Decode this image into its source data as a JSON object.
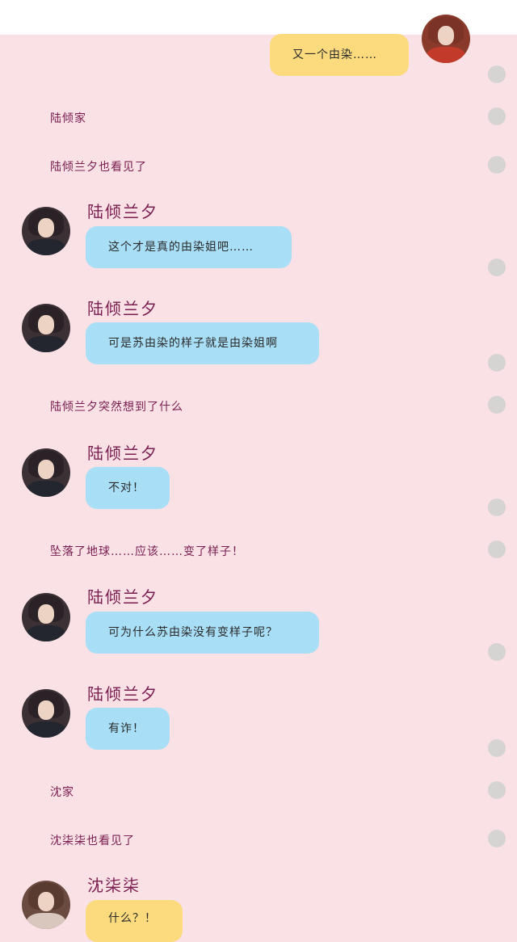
{
  "me": {
    "message": "又一个由染……"
  },
  "messages": [
    {
      "type": "narration",
      "text": "陆倾家"
    },
    {
      "type": "narration",
      "text": "陆倾兰夕也看见了"
    },
    {
      "type": "chat",
      "speaker": "陆倾兰夕",
      "text": "这个才是真的由染姐吧……"
    },
    {
      "type": "chat",
      "speaker": "陆倾兰夕",
      "text": "可是苏由染的样子就是由染姐啊"
    },
    {
      "type": "narration",
      "text": "陆倾兰夕突然想到了什么"
    },
    {
      "type": "chat",
      "speaker": "陆倾兰夕",
      "text": "不对！"
    },
    {
      "type": "narration",
      "text": "坠落了地球……应该……变了样子！"
    },
    {
      "type": "chat",
      "speaker": "陆倾兰夕",
      "text": "可为什么苏由染没有变样子呢？"
    },
    {
      "type": "chat",
      "speaker": "陆倾兰夕",
      "text": "有诈！"
    },
    {
      "type": "narration",
      "text": "沈家"
    },
    {
      "type": "narration",
      "text": "沈柒柒也看见了"
    },
    {
      "type": "chat",
      "speaker": "沈柒柒",
      "text": "什么？！"
    }
  ]
}
